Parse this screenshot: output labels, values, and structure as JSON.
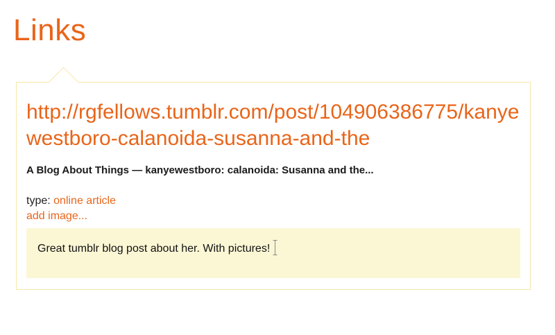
{
  "section": {
    "title": "Links"
  },
  "link": {
    "url": "http://rgfellows.tumblr.com/post/104906386775/kanyewestboro-calanoida-susanna-and-the",
    "title": "A Blog About Things — kanyewestboro: calanoida: Susanna and the...",
    "type_label": "type:",
    "type_value": "online article",
    "add_image_label": "add image...",
    "notes": "Great tumblr blog post about her. With pictures!"
  },
  "icons": {
    "text_cursor": "text-cursor-icon"
  },
  "colors": {
    "accent": "#e8651a",
    "notes_background": "#fbf7d5",
    "card_border": "#f6e7a6"
  }
}
